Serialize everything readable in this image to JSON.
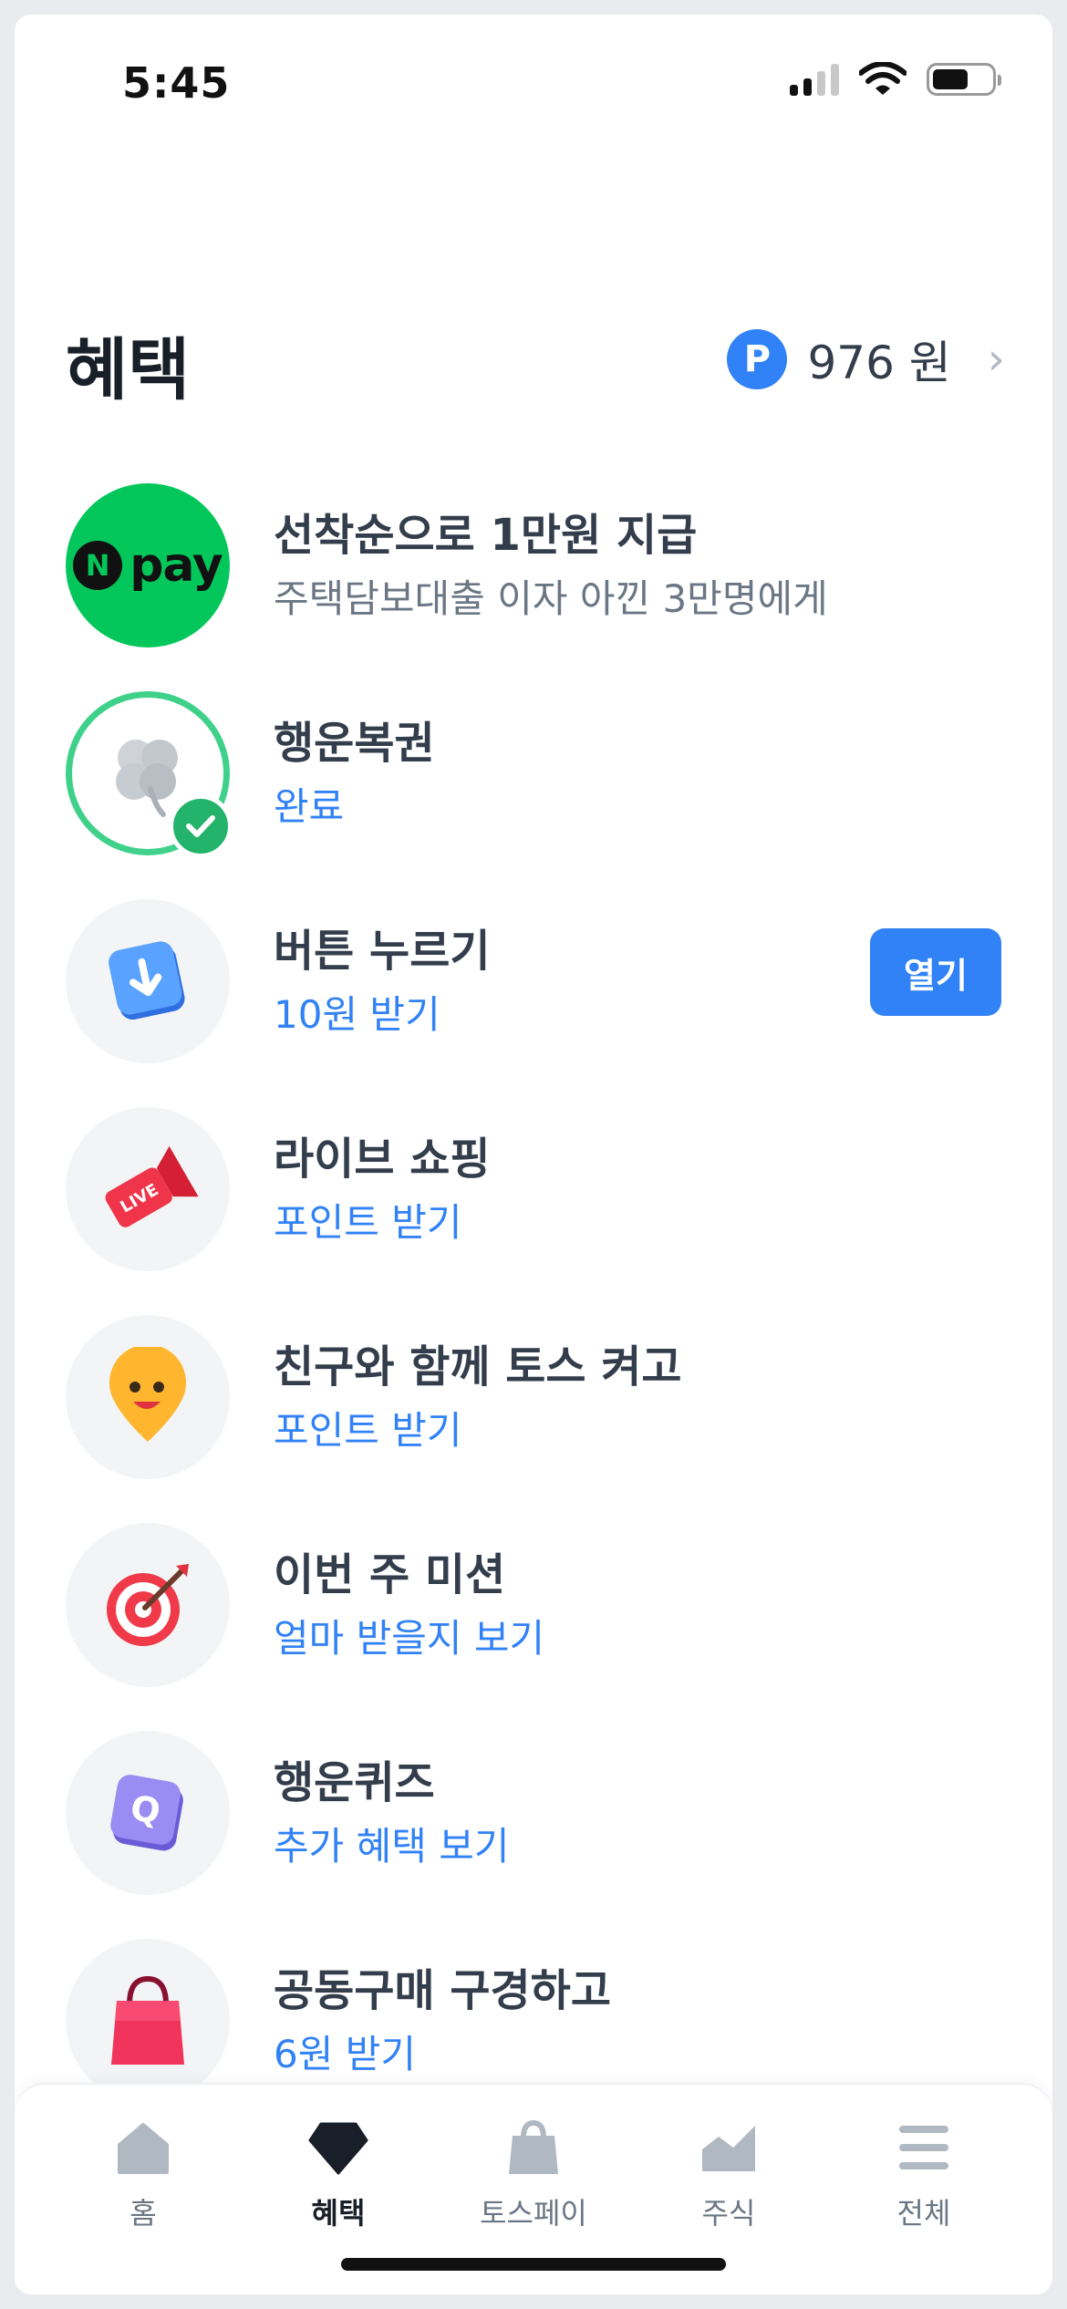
{
  "status_bar": {
    "time": "5:45"
  },
  "header": {
    "title": "혜택",
    "points_badge": "P",
    "points_value": "976 원"
  },
  "list": [
    {
      "title": "선착순으로 1만원 지급",
      "subtitle": "주택담보대출 이자 아낀 3만명에게",
      "icon": "npay-logo"
    },
    {
      "title": "행운복권",
      "subtitle": "완료",
      "icon": "clover-icon"
    },
    {
      "title": "버튼 누르기",
      "subtitle": "10원 받기",
      "icon": "down-button-icon",
      "button": "열기"
    },
    {
      "title": "라이브 쇼핑",
      "subtitle": "포인트 받기",
      "icon": "live-megaphone-icon"
    },
    {
      "title": "친구와 함께 토스 켜고",
      "subtitle": "포인트 받기",
      "icon": "smile-pin-icon"
    },
    {
      "title": "이번 주 미션",
      "subtitle": "얼마 받을지 보기",
      "icon": "target-icon"
    },
    {
      "title": "행운퀴즈",
      "subtitle": "추가 혜택 보기",
      "icon": "quiz-icon"
    },
    {
      "title": "공동구매 구경하고",
      "subtitle": "6원 받기",
      "icon": "shopping-bag-icon"
    }
  ],
  "npay": {
    "n": "N",
    "text": "pay"
  },
  "live_badge": "LIVE",
  "quiz_letter": "Q",
  "tabbar": [
    {
      "label": "홈",
      "icon": "home-icon",
      "active": false
    },
    {
      "label": "혜택",
      "icon": "diamond-icon",
      "active": true
    },
    {
      "label": "토스페이",
      "icon": "bag-icon",
      "active": false
    },
    {
      "label": "주식",
      "icon": "chart-icon",
      "active": false
    },
    {
      "label": "전체",
      "icon": "menu-icon",
      "active": false
    }
  ],
  "colors": {
    "accent": "#3182f6",
    "npay_green": "#03c75a",
    "check_green": "#24b36b"
  }
}
